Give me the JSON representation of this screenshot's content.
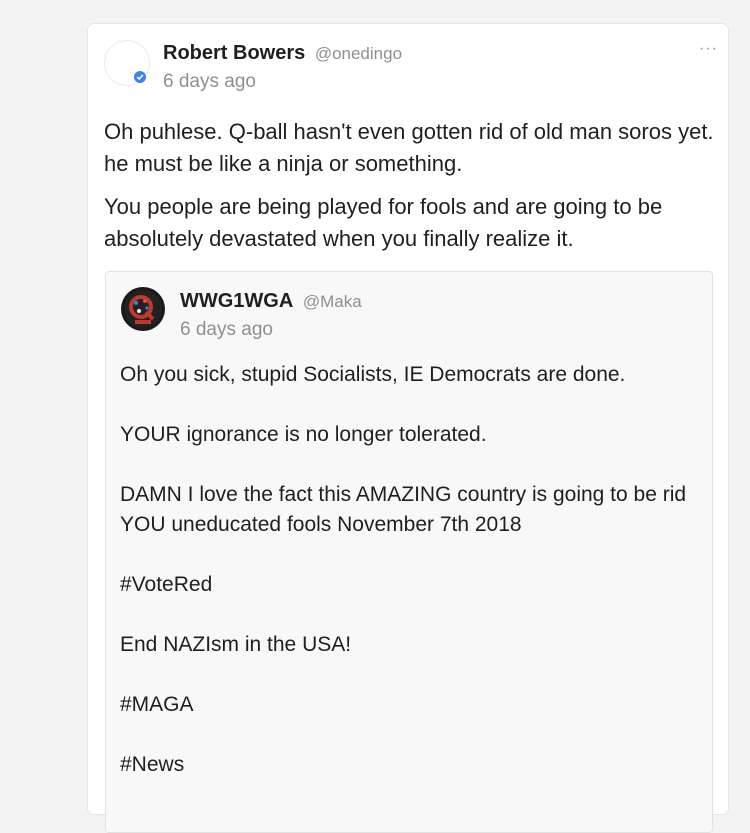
{
  "post": {
    "author_name": "Robert Bowers",
    "author_handle": "@onedingo",
    "timestamp": "6 days ago",
    "more_icon": "···",
    "paragraphs": [
      "Oh puhlese. Q-ball hasn't even gotten rid of old man soros yet. he must be like a ninja or something.",
      "You people are being played for fools and are going to be absolutely devastated when you finally realize it."
    ],
    "verified_color": "#3b82f6"
  },
  "quoted": {
    "author_name": "WWG1WGA",
    "author_handle": "@Maka",
    "timestamp": "6 days ago",
    "lines": [
      "Oh you sick, stupid Socialists, IE Democrats are done.",
      "YOUR ignorance is no longer tolerated.",
      "DAMN I love the fact this AMAZING country is going to be rid YOU uneducated fools November 7th 2018",
      "#VoteRed",
      "End NAZIsm in the USA!",
      "#MAGA",
      "#News"
    ]
  }
}
